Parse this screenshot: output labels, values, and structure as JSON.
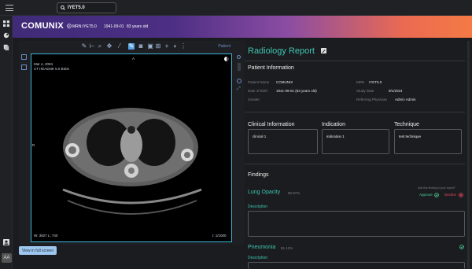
{
  "topbar": {
    "search_value": "IYET5.0"
  },
  "header": {
    "brand": "COMUNIX",
    "mrn": "MRN:IYET5.0",
    "dob": "1941-09-01",
    "age": "83 years old"
  },
  "viewer": {
    "patient_label": "Patient",
    "ct_date": "Mar 4, 2004",
    "ct_series": "CT HEADNK 5.0 B30s",
    "window_level": "W: 3927  L: 740",
    "scale": "I: 1/1000",
    "orientation_top": "A",
    "orientation_left": "R",
    "fullscreen_label": "View in full screen"
  },
  "report": {
    "title": "Radiology Report",
    "patient_info_title": "Patient Information",
    "labels": {
      "patient_name": "Patient Name",
      "dob": "Date of Birth",
      "gender": "Gender",
      "mrn": "MRN",
      "study_date": "Study Date",
      "referring": "Referring Physician"
    },
    "values": {
      "patient_name": "COMUNIX",
      "dob": "1941-09-01 (83 years old)",
      "mrn": "IYET5.0",
      "study_date": "9/1/2024",
      "referring": "Admin Admin"
    },
    "clinical_title": "Clinical Information",
    "indication_title": "Indication",
    "technique_title": "Technique",
    "clinical_value": "clinical 1",
    "indication_value": "indication 1",
    "technique_value": "test technique",
    "findings_title": "Findings",
    "findings": [
      {
        "name": "Lung Opacity",
        "pct": "90.97%",
        "desc_label": "Description"
      },
      {
        "name": "Pneumonia",
        "pct": "81.12%",
        "desc_label": "Description"
      }
    ],
    "add_finding_hint": "Add this finding to your report?",
    "approve_label": "Approve",
    "decline_label": "Decline"
  },
  "sidebar": {
    "font_toggle": "AA"
  }
}
